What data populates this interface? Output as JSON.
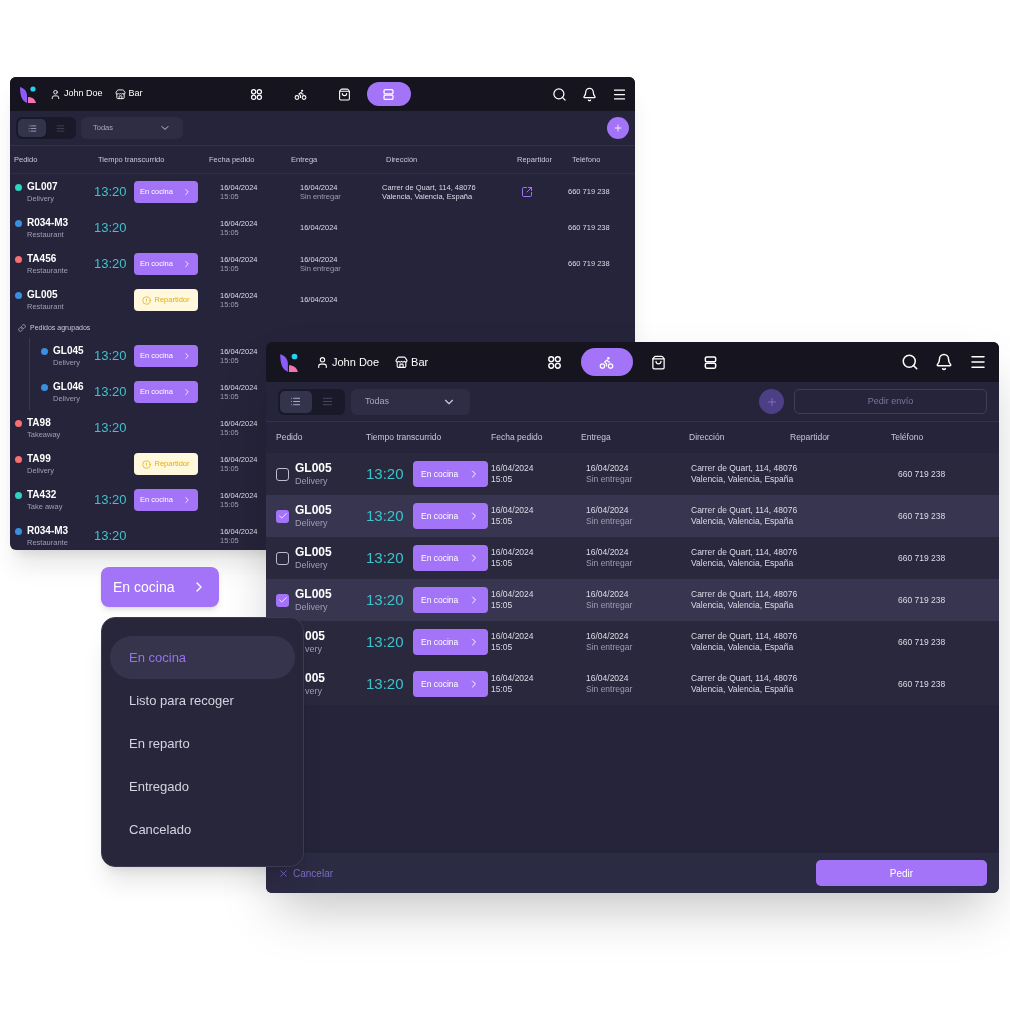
{
  "back_window": {
    "header": {
      "user": "John Doe",
      "location": "Bar",
      "nav": [
        {
          "kind": "grid",
          "selected": false
        },
        {
          "kind": "bike",
          "selected": false
        },
        {
          "kind": "bag",
          "selected": false
        },
        {
          "kind": "stack",
          "selected": true
        }
      ]
    },
    "toolbar": {
      "views": [
        {
          "kind": "cards",
          "selected": true
        },
        {
          "kind": "list",
          "selected": false
        }
      ],
      "filter": "Todas",
      "add_disabled": false
    },
    "columns": [
      "Pedido",
      "Tiempo transcurrido",
      "Fecha pedido",
      "Entrega",
      "Dirección",
      "Repartidor",
      "Teléfono"
    ],
    "rows": [
      {
        "kind": "order",
        "id": "GL007",
        "type": "Delivery",
        "color": "#2dd4bf",
        "time": "13:20",
        "status": {
          "kind": "cooking",
          "label": "En cocina"
        },
        "ordered": [
          "16/04/2024",
          "15:05"
        ],
        "delivery": [
          "16/04/2024",
          "Sin entregar"
        ],
        "address": [
          "Carrer de Quart, 114, 48076",
          "Valencia, Valencia, España"
        ],
        "courier_link": true,
        "phone": "660 719 238"
      },
      {
        "kind": "order",
        "id": "R034-M3",
        "type": "Restaurant",
        "color": "#3b8fe0",
        "time": "13:20",
        "ordered": [
          "16/04/2024",
          "15:05"
        ],
        "delivery": [
          "16/04/2024"
        ],
        "phone": "660 719 238"
      },
      {
        "kind": "order",
        "id": "TA456",
        "type": "Restaurante",
        "color": "#f87171",
        "time": "13:20",
        "status": {
          "kind": "cooking",
          "label": "En cocina"
        },
        "ordered": [
          "16/04/2024",
          "15:05"
        ],
        "delivery": [
          "16/04/2024",
          "Sin entregar"
        ],
        "phone": "660 719 238"
      },
      {
        "kind": "order",
        "id": "GL005",
        "type": "Restaurant",
        "color": "#3b8fe0",
        "status": {
          "kind": "warning",
          "label": "Repartidor"
        },
        "ordered": [
          "16/04/2024",
          "15:05"
        ],
        "delivery": [
          "16/04/2024"
        ]
      },
      {
        "kind": "group",
        "label": "Pedidos agrupados",
        "children": [
          {
            "kind": "order",
            "id": "GL045",
            "type": "Delivery",
            "color": "#3b8fe0",
            "time": "13:20",
            "status": {
              "kind": "cooking",
              "label": "En cocina"
            },
            "ordered": [
              "16/04/2024",
              "15:05"
            ]
          },
          {
            "kind": "order",
            "id": "GL046",
            "type": "Delivery",
            "color": "#3b8fe0",
            "time": "13:20",
            "status": {
              "kind": "cooking",
              "label": "En cocina"
            },
            "ordered": [
              "16/04/2024",
              "15:05"
            ]
          }
        ]
      },
      {
        "kind": "order",
        "id": "TA98",
        "type": "Takeaway",
        "color": "#f87171",
        "time": "13:20",
        "ordered": [
          "16/04/2024",
          "15:05"
        ]
      },
      {
        "kind": "order",
        "id": "TA99",
        "type": "Delivery",
        "color": "#f87171",
        "status": {
          "kind": "warning",
          "label": "Repartidor"
        },
        "ordered": [
          "16/04/2024",
          "15:05"
        ]
      },
      {
        "kind": "order",
        "id": "TA432",
        "type": "Take away",
        "color": "#2dd4bf",
        "time": "13:20",
        "status": {
          "kind": "cooking",
          "label": "En cocina"
        },
        "ordered": [
          "16/04/2024",
          "15:05"
        ]
      },
      {
        "kind": "order",
        "id": "R034-M3",
        "type": "Restaurante",
        "color": "#3b8fe0",
        "time": "13:20",
        "ordered": [
          "16/04/2024",
          "15:05"
        ]
      }
    ]
  },
  "front_window": {
    "header": {
      "user": "John Doe",
      "location": "Bar",
      "nav": [
        {
          "kind": "grid",
          "selected": false
        },
        {
          "kind": "bike",
          "selected": true
        },
        {
          "kind": "bag",
          "selected": false
        },
        {
          "kind": "stack",
          "selected": false
        }
      ]
    },
    "toolbar": {
      "views": [
        {
          "kind": "cards",
          "selected": true
        },
        {
          "kind": "list",
          "selected": false
        }
      ],
      "filter": "Todas",
      "add_disabled": true,
      "request": {
        "label": "Pedir envío",
        "disabled": true
      }
    },
    "columns": [
      "Pedido",
      "Tiempo transcurrido",
      "Fecha pedido",
      "Entrega",
      "Dirección",
      "Repartidor",
      "Teléfono"
    ],
    "rows": [
      {
        "checked": false,
        "id": "GL005",
        "type": "Delivery",
        "time": "13:20",
        "status": {
          "kind": "cooking",
          "label": "En cocina"
        },
        "ordered": [
          "16/04/2024",
          "15:05"
        ],
        "delivery": [
          "16/04/2024",
          "Sin entregar"
        ],
        "address": [
          "Carrer de Quart, 114, 48076",
          "Valencia, Valencia, España"
        ],
        "phone": "660 719 238"
      },
      {
        "checked": true,
        "id": "GL005",
        "type": "Delivery",
        "time": "13:20",
        "status": {
          "kind": "cooking",
          "label": "En cocina"
        },
        "ordered": [
          "16/04/2024",
          "15:05"
        ],
        "delivery": [
          "16/04/2024",
          "Sin entregar"
        ],
        "address": [
          "Carrer de Quart, 114, 48076",
          "Valencia, Valencia, España"
        ],
        "phone": "660 719 238"
      },
      {
        "checked": false,
        "id": "GL005",
        "type": "Delivery",
        "time": "13:20",
        "status": {
          "kind": "cooking",
          "label": "En cocina"
        },
        "ordered": [
          "16/04/2024",
          "15:05"
        ],
        "delivery": [
          "16/04/2024",
          "Sin entregar"
        ],
        "address": [
          "Carrer de Quart, 114, 48076",
          "Valencia, Valencia, España"
        ],
        "phone": "660 719 238"
      },
      {
        "checked": true,
        "id": "GL005",
        "type": "Delivery",
        "time": "13:20",
        "status": {
          "kind": "cooking",
          "label": "En cocina"
        },
        "ordered": [
          "16/04/2024",
          "15:05"
        ],
        "delivery": [
          "16/04/2024",
          "Sin entregar"
        ],
        "address": [
          "Carrer de Quart, 114, 48076",
          "Valencia, Valencia, España"
        ],
        "phone": "660 719 238"
      },
      {
        "id": "005",
        "type": "very",
        "time": "13:20",
        "status": {
          "kind": "cooking",
          "label": "En cocina"
        },
        "ordered": [
          "16/04/2024",
          "15:05"
        ],
        "delivery": [
          "16/04/2024",
          "Sin entregar"
        ],
        "address": [
          "Carrer de Quart, 114, 48076",
          "Valencia, Valencia, España"
        ],
        "phone": "660 719 238"
      },
      {
        "id": "005",
        "type": "very",
        "time": "13:20",
        "status": {
          "kind": "cooking",
          "label": "En cocina"
        },
        "ordered": [
          "16/04/2024",
          "15:05"
        ],
        "delivery": [
          "16/04/2024",
          "Sin entregar"
        ],
        "address": [
          "Carrer de Quart, 114, 48076",
          "Valencia, Valencia, España"
        ],
        "phone": "660 719 238"
      }
    ],
    "footer": {
      "cancel": "Cancelar",
      "submit": "Pedir"
    }
  },
  "status_button": {
    "label": "En cocina"
  },
  "status_menu": [
    {
      "label": "En cocina",
      "selected": true
    },
    {
      "label": "Listo para recoger",
      "selected": false
    },
    {
      "label": "En reparto",
      "selected": false
    },
    {
      "label": "Entregado",
      "selected": false
    },
    {
      "label": "Cancelado",
      "selected": false
    }
  ]
}
